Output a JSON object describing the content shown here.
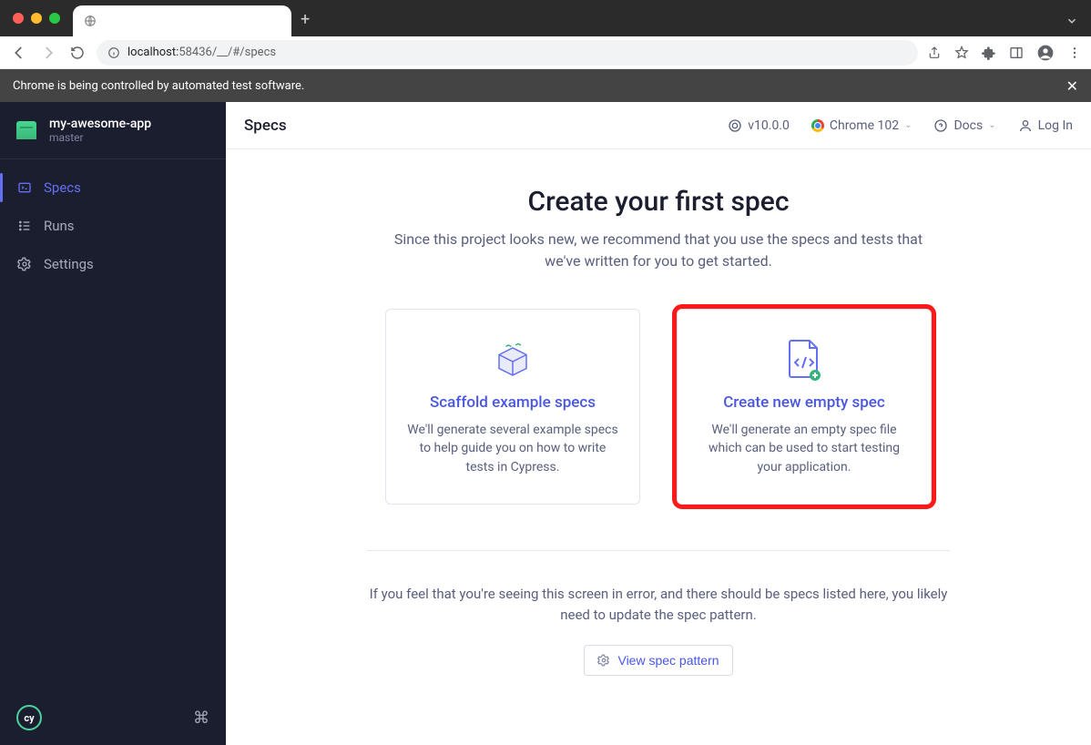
{
  "browser": {
    "url_host": "localhost:",
    "url_port": "58436",
    "url_path": "/__/#/specs",
    "info_bar": "Chrome is being controlled by automated test software."
  },
  "sidebar": {
    "project_name": "my-awesome-app",
    "branch": "master",
    "items": [
      {
        "label": "Specs"
      },
      {
        "label": "Runs"
      },
      {
        "label": "Settings"
      }
    ],
    "logo_text": "cy"
  },
  "header": {
    "title": "Specs",
    "version": "v10.0.0",
    "browser": "Chrome 102",
    "docs": "Docs",
    "login": "Log In"
  },
  "main": {
    "heading": "Create your first spec",
    "subtitle": "Since this project looks new, we recommend that you use the specs and tests that we've written for you to get started.",
    "cards": [
      {
        "title": "Scaffold example specs",
        "desc": "We'll generate several example specs to help guide you on how to write tests in Cypress."
      },
      {
        "title": "Create new empty spec",
        "desc": "We'll generate an empty spec file which can be used to start testing your application."
      }
    ],
    "footer_note": "If you feel that you're seeing this screen in error, and there should be specs listed here, you likely need to update the spec pattern.",
    "view_pattern": "View spec pattern"
  }
}
